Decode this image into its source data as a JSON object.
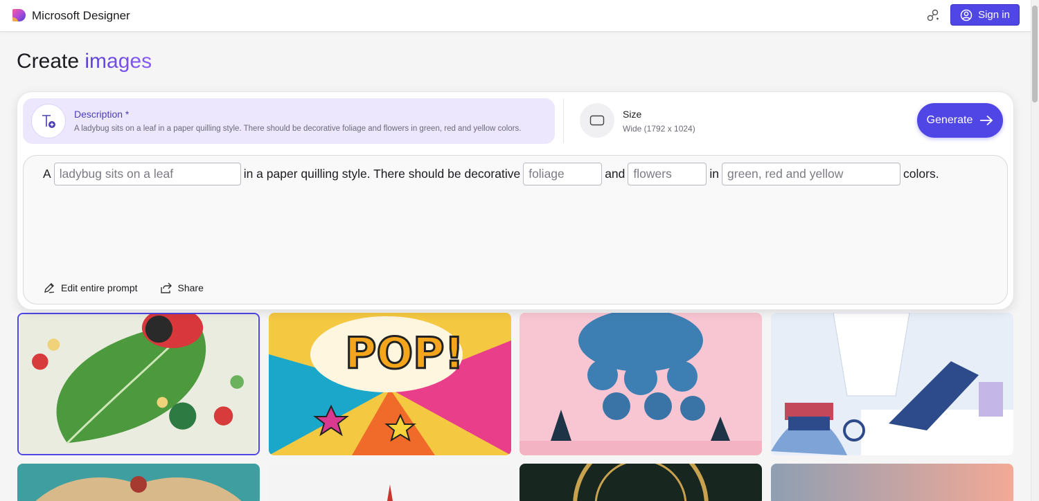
{
  "header": {
    "app_name": "Microsoft Designer",
    "icons": [
      "designer-logo-icon",
      "connect-icon",
      "user-circle-icon"
    ],
    "signin_label": "Sign in"
  },
  "page": {
    "title_prefix": "Create",
    "title_accent": "images"
  },
  "description": {
    "label": "Description *",
    "text": "A ladybug sits on a leaf in a paper quilling style. There should be decorative foliage and flowers in green, red and yellow colors."
  },
  "size": {
    "label": "Size",
    "value": "Wide (1792 x 1024)"
  },
  "generate_label": "Generate",
  "prompt": {
    "t1": "A",
    "slot1": "ladybug sits on a leaf",
    "t2": "in a paper quilling style. There should be decorative",
    "slot2": "foliage",
    "t3": "and",
    "slot3": "flowers",
    "t4": "in",
    "slot4": "green, red and yellow",
    "t5": "colors."
  },
  "actions": {
    "edit_label": "Edit entire prompt",
    "share_label": "Share"
  },
  "gallery": {
    "items": [
      "quilled-ladybug",
      "pop-art",
      "blue-trees",
      "laptop-illustration",
      "ornate-teal",
      "minimal-white",
      "dark-gold-medallion",
      "pink-gradient"
    ]
  },
  "colors": {
    "accent": "#4f46e5",
    "description_bg": "#ece7fd"
  }
}
